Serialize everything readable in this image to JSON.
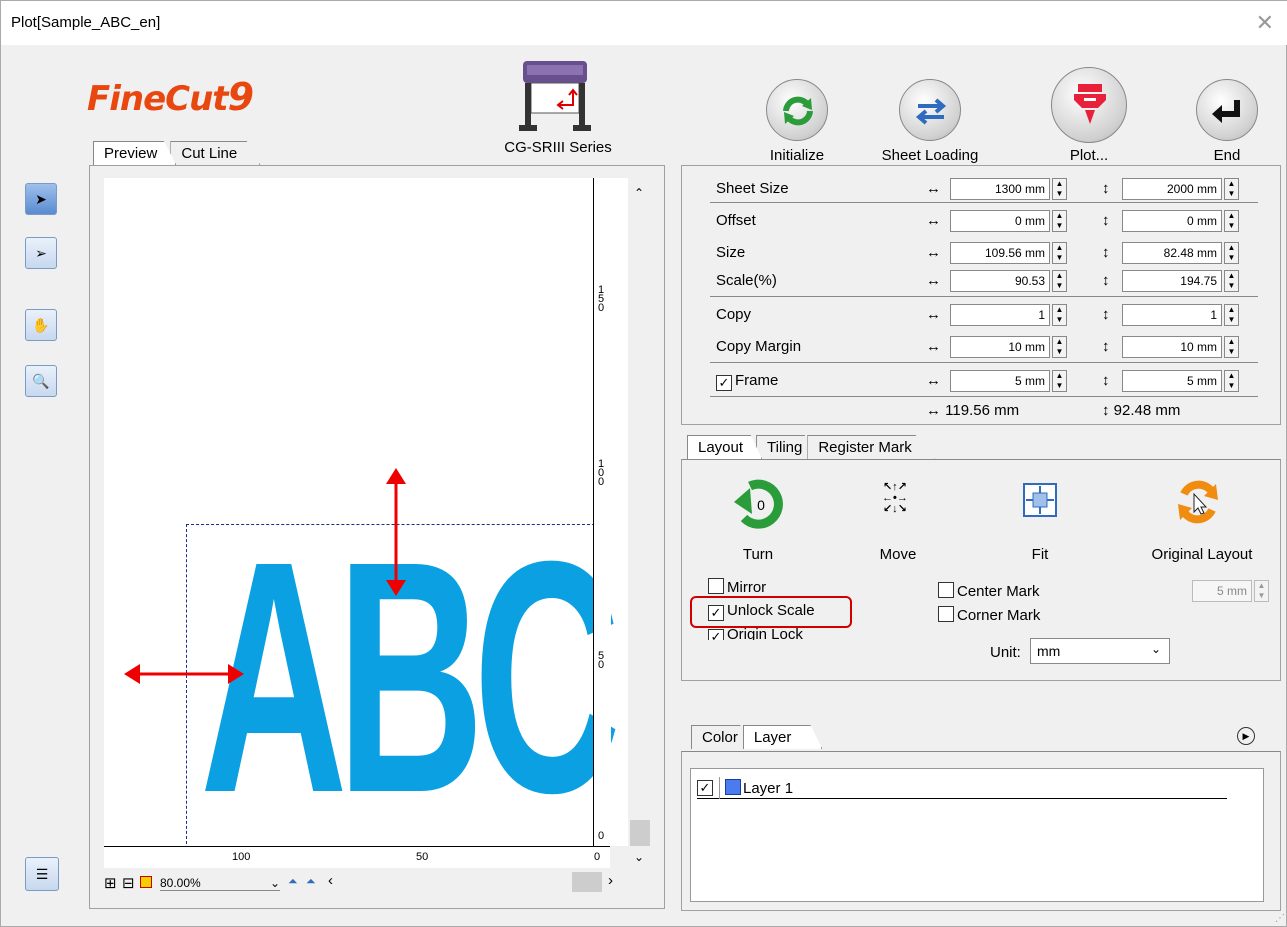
{
  "window": {
    "title": "Plot[Sample_ABC_en]",
    "close": "✕"
  },
  "logo": {
    "text": "FineCut",
    "num": "9"
  },
  "device": {
    "series": "CG-SRIII Series"
  },
  "toolbar": {
    "initialize": "Initialize",
    "sheet_loading": "Sheet Loading",
    "plot": "Plot...",
    "end": "End"
  },
  "preview_tabs": {
    "preview": "Preview",
    "cut_line": "Cut Line"
  },
  "preview": {
    "text": "ABC",
    "zoom": "80.00%",
    "vruler": [
      "1\n5\n0",
      "1\n0\n0",
      "5\n0",
      "0"
    ],
    "hruler": [
      "100",
      "50",
      "0"
    ]
  },
  "settings": {
    "sheet_size": {
      "label": "Sheet Size",
      "w": "1300 mm",
      "h": "2000 mm"
    },
    "offset": {
      "label": "Offset",
      "w": "0 mm",
      "h": "0 mm"
    },
    "size": {
      "label": "Size",
      "w": "109.56 mm",
      "h": "82.48 mm"
    },
    "scale": {
      "label": "Scale(%)",
      "w": "90.53",
      "h": "194.75"
    },
    "copy": {
      "label": "Copy",
      "w": "1",
      "h": "1"
    },
    "copy_margin": {
      "label": "Copy Margin",
      "w": "10 mm",
      "h": "10 mm"
    },
    "frame": {
      "label": "Frame",
      "w": "5 mm",
      "h": "5 mm"
    },
    "total_w": "↔ 119.56 mm",
    "total_h": "↕ 92.48 mm"
  },
  "layout_tabs": {
    "layout": "Layout",
    "tiling": "Tiling",
    "register_mark": "Register Mark"
  },
  "layout": {
    "turn": "Turn",
    "turn_value": "0",
    "move": "Move",
    "fit": "Fit",
    "original_layout": "Original Layout",
    "mirror": "Mirror",
    "unlock_scale": "Unlock Scale",
    "origin_lock": "Origin Lock",
    "center_mark": "Center Mark",
    "corner_mark": "Corner Mark",
    "mark_size": "5 mm",
    "unit_label": "Unit:",
    "unit_value": "mm"
  },
  "color_tabs": {
    "color": "Color",
    "layer": "Layer"
  },
  "layers": [
    {
      "name": "Layer 1"
    }
  ],
  "colors": {
    "abc": "#0aa0e2",
    "highlight": "#d00000",
    "arrow": "#e00000"
  }
}
